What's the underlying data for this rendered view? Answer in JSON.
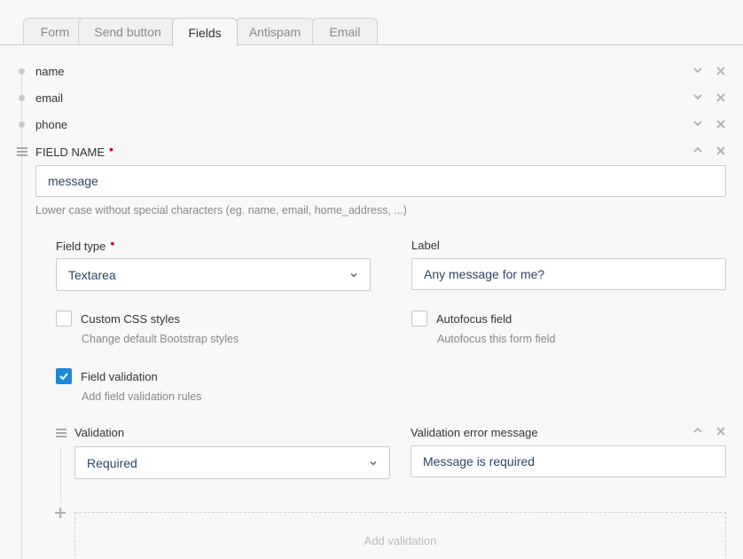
{
  "tabs": [
    {
      "label": "Form"
    },
    {
      "label": "Send button"
    },
    {
      "label": "Fields"
    },
    {
      "label": "Antispam"
    },
    {
      "label": "Email"
    }
  ],
  "collapsed_fields": [
    {
      "label": "name"
    },
    {
      "label": "email"
    },
    {
      "label": "phone"
    }
  ],
  "field": {
    "name_label": "FIELD NAME",
    "name_value": "message",
    "name_help": "Lower case without special characters (eg. name, email, home_address, ...)",
    "type_label": "Field type",
    "type_value": "Textarea",
    "label_label": "Label",
    "label_value": "Any message for me?",
    "custom_css_label": "Custom CSS styles",
    "custom_css_help": "Change default Bootstrap styles",
    "custom_css_checked": false,
    "autofocus_label": "Autofocus field",
    "autofocus_help": "Autofocus this form field",
    "autofocus_checked": false,
    "validation_label": "Field validation",
    "validation_help": "Add field validation rules",
    "validation_checked": true
  },
  "validation": {
    "rule_label": "Validation",
    "rule_value": "Required",
    "error_label": "Validation error message",
    "error_value": "Message is required",
    "add_label": "Add validation"
  },
  "colors": {
    "accent": "#1e88d9",
    "required": "#cc0000",
    "input_text": "#2d4466"
  }
}
